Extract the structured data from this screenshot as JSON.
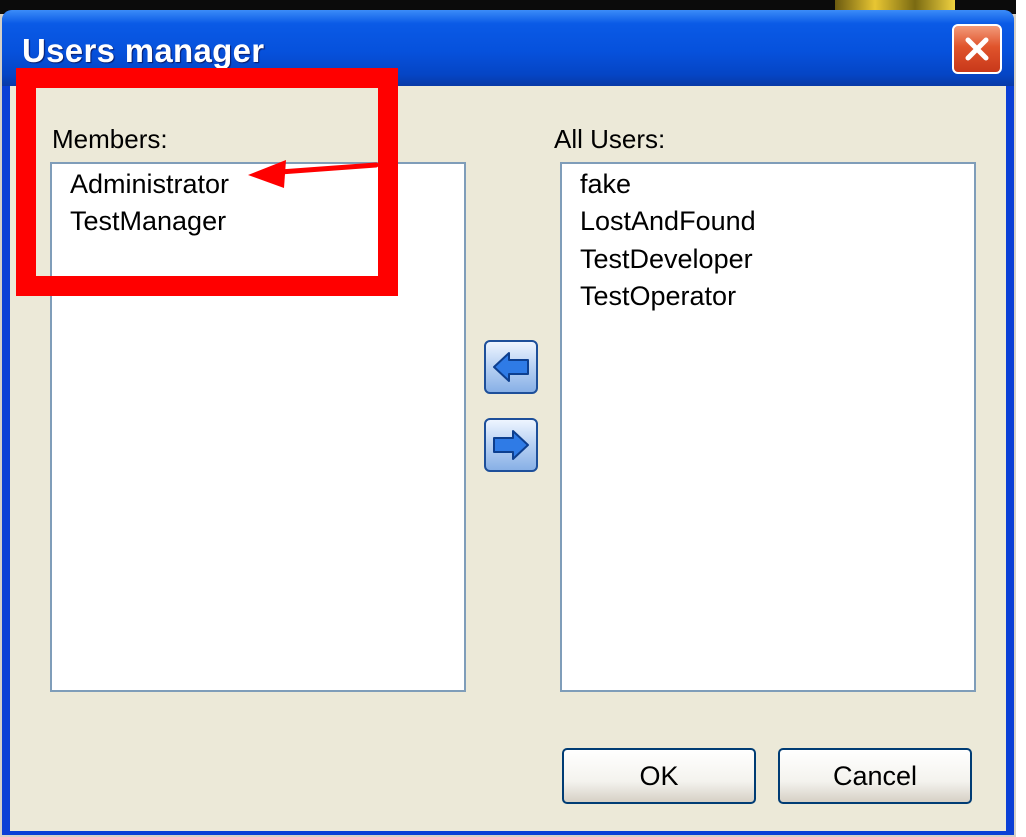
{
  "window": {
    "title": "Users manager"
  },
  "members": {
    "label": "Members:",
    "items": [
      "Administrator",
      "TestManager"
    ]
  },
  "all_users": {
    "label": "All Users:",
    "items": [
      "fake",
      "LostAndFound",
      "TestDeveloper",
      "TestOperator"
    ]
  },
  "buttons": {
    "ok_label": "OK",
    "cancel_label": "Cancel"
  },
  "icons": {
    "close": "close-icon",
    "move_left": "arrow-left-icon",
    "move_right": "arrow-right-icon"
  },
  "colors": {
    "titlebar": "#0651dc",
    "annotation": "#ff0000",
    "list_border": "#7f9db9",
    "arrow_button": "#2f7be6"
  }
}
